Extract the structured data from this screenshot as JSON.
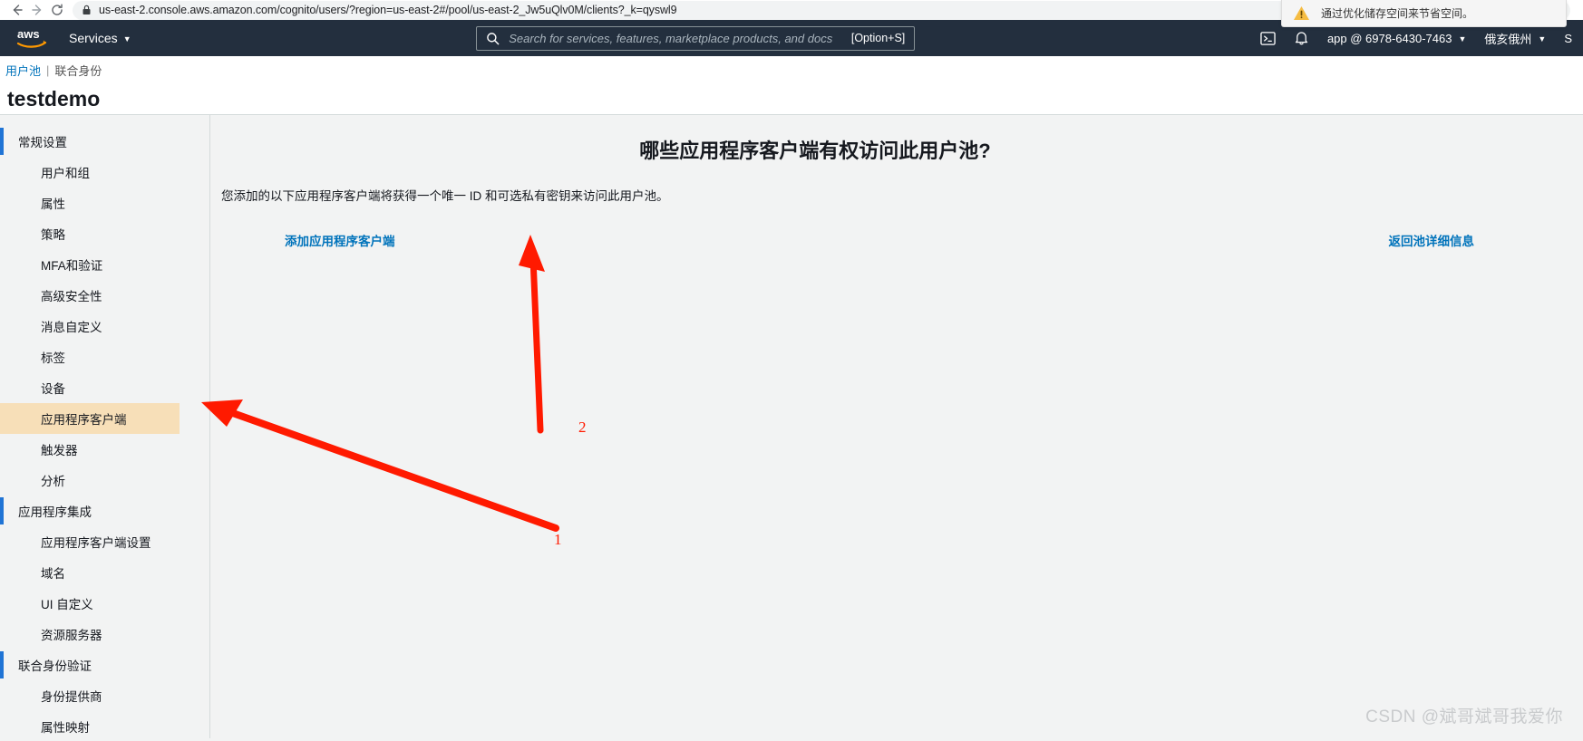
{
  "browser": {
    "back_icon": "arrow-left-icon",
    "forward_icon": "arrow-right-icon",
    "reload_icon": "reload-icon",
    "lock_icon": "lock-icon",
    "url": "us-east-2.console.aws.amazon.com/cognito/users/?region=us-east-2#/pool/us-east-2_Jw5uQlv0M/clients?_k=qyswl9",
    "toast": {
      "icon": "warning-triangle-icon",
      "text": "通过优化储存空间来节省空间。"
    }
  },
  "aws_nav": {
    "logo": "aws-logo",
    "services_label": "Services",
    "search": {
      "icon": "search-icon",
      "placeholder": "Search for services, features, marketplace products, and docs",
      "shortcut": "[Option+S]",
      "value": ""
    },
    "cloudshell_icon": "cloudshell-icon",
    "bell_icon": "bell-icon",
    "account_label": "app @ 6978-6430-7463",
    "region_label": "俄亥俄州",
    "support_label": "S"
  },
  "breadcrumb": {
    "active": "用户池",
    "separator": "|",
    "inactive": "联合身份"
  },
  "page": {
    "title": "testdemo"
  },
  "sidebar": {
    "groups": [
      {
        "label": "常规设置",
        "items": [
          {
            "label": "用户和组",
            "active": false
          },
          {
            "label": "属性",
            "active": false
          },
          {
            "label": "策略",
            "active": false
          },
          {
            "label": "MFA和验证",
            "active": false
          },
          {
            "label": "高级安全性",
            "active": false
          },
          {
            "label": "消息自定义",
            "active": false
          },
          {
            "label": "标签",
            "active": false
          },
          {
            "label": "设备",
            "active": false
          },
          {
            "label": "应用程序客户端",
            "active": true
          },
          {
            "label": "触发器",
            "active": false
          },
          {
            "label": "分析",
            "active": false
          }
        ]
      },
      {
        "label": "应用程序集成",
        "items": [
          {
            "label": "应用程序客户端设置",
            "active": false
          },
          {
            "label": "域名",
            "active": false
          },
          {
            "label": "UI 自定义",
            "active": false
          },
          {
            "label": "资源服务器",
            "active": false
          }
        ]
      },
      {
        "label": "联合身份验证",
        "items": [
          {
            "label": "身份提供商",
            "active": false
          },
          {
            "label": "属性映射",
            "active": false
          }
        ]
      }
    ]
  },
  "main": {
    "heading": "哪些应用程序客户端有权访问此用户池?",
    "description": "您添加的以下应用程序客户端将获得一个唯一 ID 和可选私有密钥来访问此用户池。",
    "add_client_link": "添加应用程序客户端",
    "return_link": "返回池详细信息"
  },
  "annotations": {
    "arrow_color": "#ff1a00",
    "markers": [
      {
        "label": "1",
        "points_to": "应用程序客户端"
      },
      {
        "label": "2",
        "points_to": "添加应用程序客户端"
      }
    ]
  },
  "watermark": {
    "text": "CSDN @斌哥斌哥我爱你"
  }
}
